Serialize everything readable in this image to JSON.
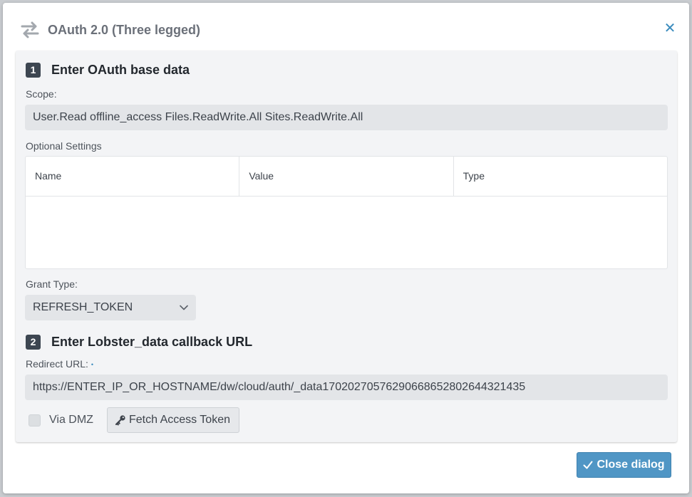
{
  "dialog": {
    "title": "OAuth 2.0 (Three legged)",
    "icon": "swap-arrows-icon",
    "close_icon": "close-icon"
  },
  "step1": {
    "number": "1",
    "title": "Enter OAuth base data",
    "scope_label": "Scope:",
    "scope_value": "User.Read offline_access Files.ReadWrite.All Sites.ReadWrite.All",
    "optional_settings_label": "Optional Settings",
    "table": {
      "columns": [
        "Name",
        "Value",
        "Type"
      ],
      "rows": []
    },
    "grant_type_label": "Grant Type:",
    "grant_type_value": "REFRESH_TOKEN"
  },
  "step2": {
    "number": "2",
    "title": "Enter Lobster_data callback URL",
    "redirect_label": "Redirect URL:",
    "required_marker": "•",
    "redirect_value": "https://ENTER_IP_OR_HOSTNAME/dw/cloud/auth/_data17020270576290668652802644321435",
    "via_dmz_label": "Via DMZ",
    "via_dmz_checked": false,
    "fetch_button_label": "Fetch Access Token",
    "fetch_icon": "key-icon"
  },
  "footer": {
    "close_button_label": "Close dialog",
    "close_button_icon": "check-icon"
  },
  "colors": {
    "accent": "#5096c5",
    "link": "#3a8bbd",
    "step_badge": "#3d4651",
    "field_bg": "#e3e5e8",
    "panel_bg": "#f3f4f6"
  }
}
